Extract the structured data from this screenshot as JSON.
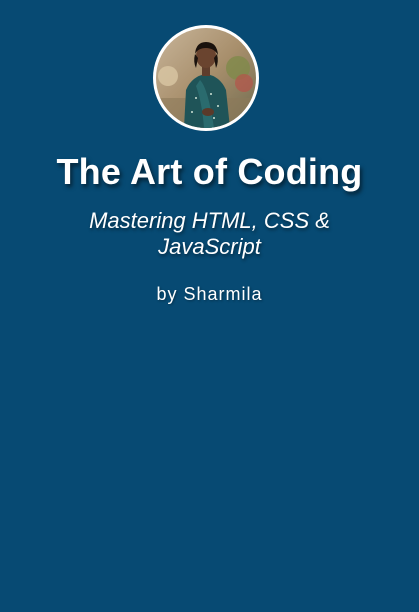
{
  "cover": {
    "title": "The Art of Coding",
    "subtitle": "Mastering HTML, CSS & JavaScript",
    "author": "by Sharmila",
    "background_color": "#074a73",
    "avatar": {
      "icon": "author-photo",
      "border_color": "#ffffff"
    }
  }
}
